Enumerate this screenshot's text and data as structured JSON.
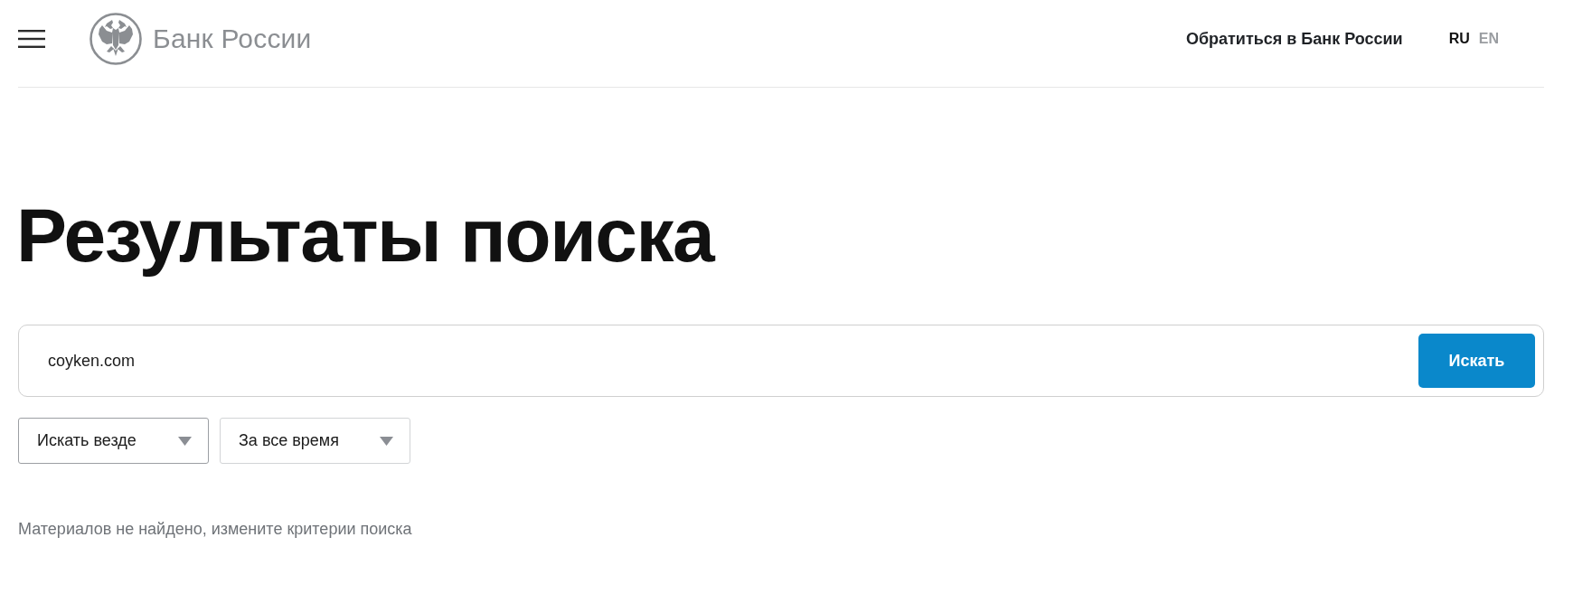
{
  "header": {
    "logo_text": "Банк России",
    "contact_link": "Обратиться в Банк России",
    "languages": [
      {
        "label": "RU",
        "selected": true
      },
      {
        "label": "EN",
        "selected": false
      }
    ]
  },
  "title": "Результаты поиска",
  "search": {
    "value": "coyken.com",
    "button": "Искать"
  },
  "filters": [
    {
      "label": "Искать везде",
      "focused": true
    },
    {
      "label": "За все время",
      "focused": false
    }
  ],
  "message": "Материалов не найдено, измените критерии поиска"
}
